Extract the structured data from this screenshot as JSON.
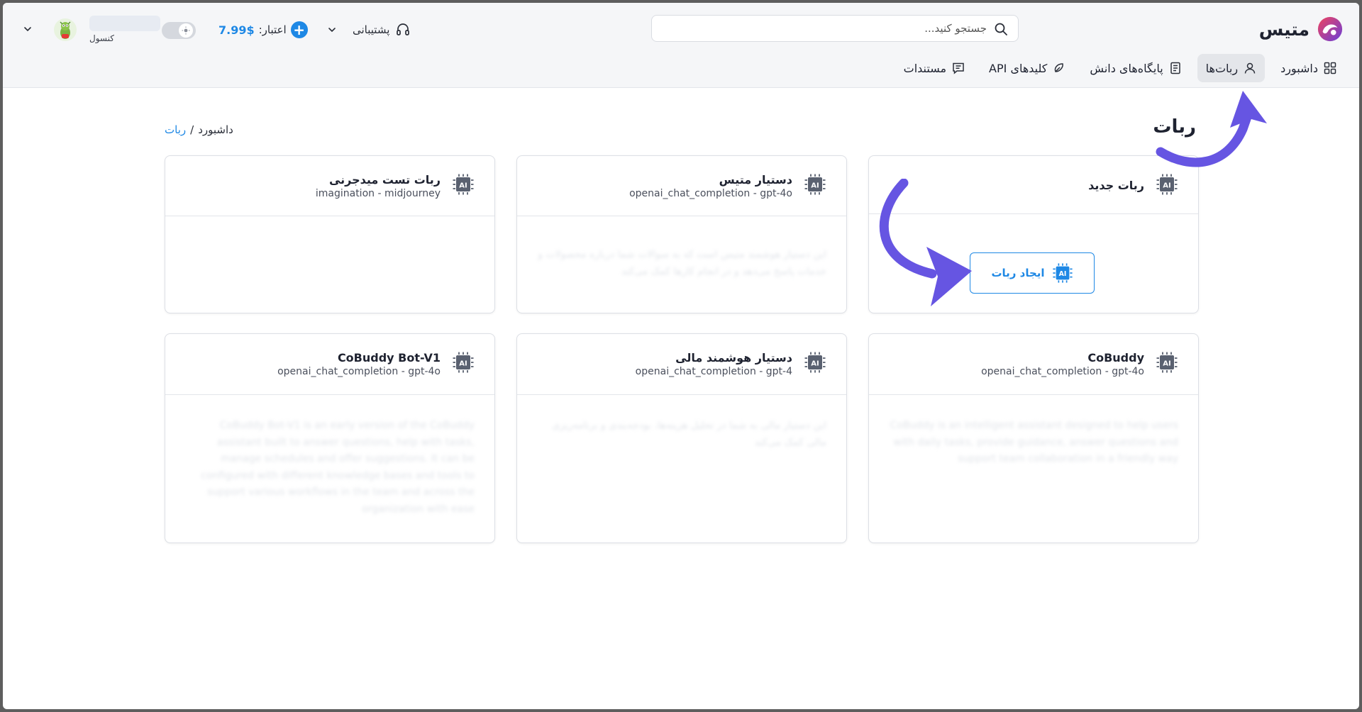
{
  "brand": {
    "name": "متیس",
    "colors": {
      "accent": "#1e88e5",
      "logo_red": "#f0435f",
      "logo_purple": "#6a3fd8",
      "annotation_arrow": "#6655e2"
    }
  },
  "search": {
    "placeholder": "جستجو کنید...",
    "icon": "search-icon"
  },
  "header": {
    "support_label": "پشتیبانی",
    "credit_label": "اعتبار:",
    "credit_value": "7.99$",
    "user_role": "کنسول"
  },
  "nav": {
    "items": [
      {
        "label": "داشبورد",
        "icon": "grid-icon",
        "active": false
      },
      {
        "label": "ربات‌ها",
        "icon": "user-icon",
        "active": true
      },
      {
        "label": "پایگاه‌های دانش",
        "icon": "book-icon",
        "active": false
      },
      {
        "label": "کلیدهای API",
        "icon": "key-icon",
        "active": false
      },
      {
        "label": "مستندات",
        "icon": "document-icon",
        "active": false
      }
    ]
  },
  "page": {
    "title": "ربات",
    "breadcrumb": {
      "parent": "داشبورد",
      "separator": "/",
      "current": "ربات"
    }
  },
  "new_bot": {
    "title": "ربات جدید",
    "button_label": "ایجاد ربات",
    "icon_text": "AI"
  },
  "bots": [
    {
      "name": "دستیار متیس",
      "model": "openai_chat_completion - gpt-4o",
      "description": "این دستیار هوشمند متیس است که به سوالات شما درباره محصولات و خدمات پاسخ می‌دهد و در انجام کارها کمک می‌کند"
    },
    {
      "name": "ربات تست میدجرنی",
      "model": "imagination - midjourney",
      "description": ""
    },
    {
      "name": "CoBuddy",
      "model": "openai_chat_completion - gpt-4o",
      "description": "CoBuddy is an intelligent assistant designed to help users with daily tasks, provide guidance, answer questions and support team collaboration in a friendly way"
    },
    {
      "name": "دستیار هوشمند مالی",
      "model": "openai_chat_completion - gpt-4",
      "description": "این دستیار مالی به شما در تحلیل هزینه‌ها، بودجه‌بندی و برنامه‌ریزی مالی کمک می‌کند"
    },
    {
      "name": "CoBuddy Bot-V1",
      "model": "openai_chat_completion - gpt-4o",
      "description": "CoBuddy Bot-V1 is an early version of the CoBuddy assistant built to answer questions, help with tasks, manage schedules and offer suggestions. It can be configured with different knowledge bases and tools to support various workflows in the team and across the organization with ease"
    }
  ]
}
